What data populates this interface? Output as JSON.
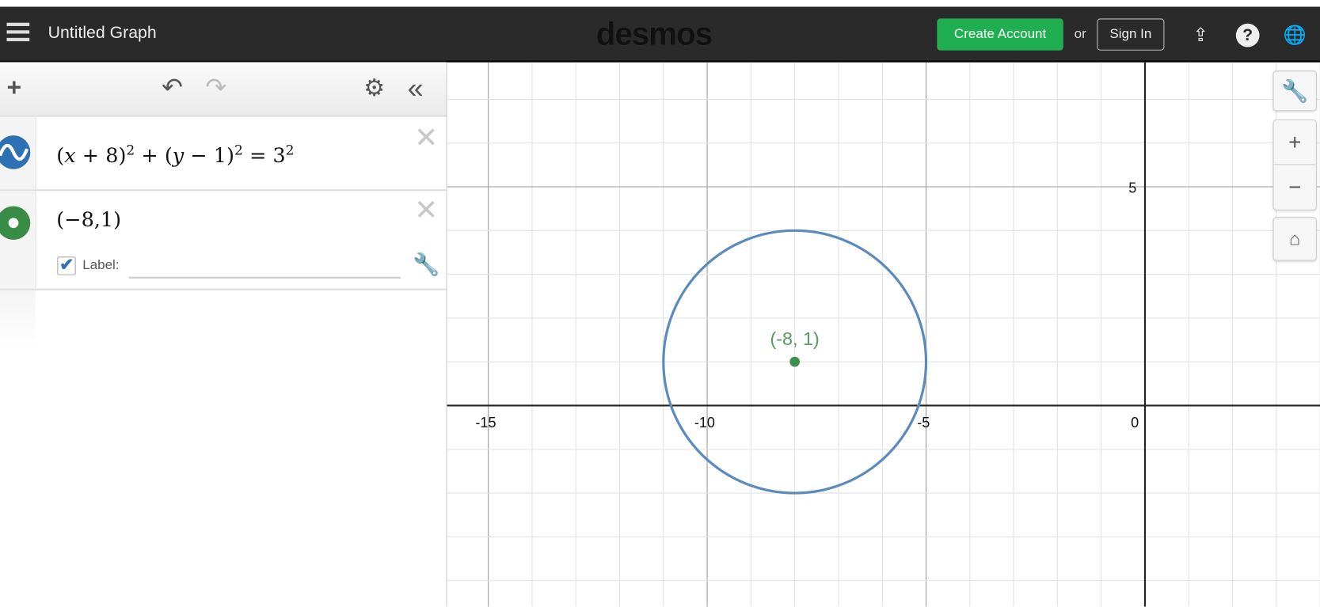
{
  "header": {
    "menu_icon": "hamburger-icon",
    "title": "Untitled Graph",
    "logo": "desmos",
    "create_account": "Create Account",
    "or": "or",
    "sign_in": "Sign In",
    "icons": [
      "share-icon",
      "help-icon",
      "globe-icon"
    ]
  },
  "toolbar": {
    "add": "+",
    "undo": "↶",
    "redo": "↷",
    "settings": "⚙",
    "collapse": "«"
  },
  "expressions": [
    {
      "type": "implicit",
      "color": "#2d70b3",
      "latex": "(x+8)^2+(y-1)^2=3^2"
    },
    {
      "type": "point",
      "color": "#388c46",
      "latex": "(−8,1)",
      "label_checkbox": true,
      "label_text": "Label:",
      "label_value": ""
    }
  ],
  "graph": {
    "x_ticks": [
      "-15",
      "-10",
      "-5",
      "0"
    ],
    "y_ticks": [
      "5"
    ],
    "circle": {
      "cx": -8,
      "cy": 1,
      "r": 3,
      "color": "#5b8bbd"
    },
    "point": {
      "x": -8,
      "y": 1,
      "label": "(-8, 1)",
      "color": "#3f8f4e"
    }
  },
  "controls": {
    "wrench": "wrench-icon",
    "zoom_in": "+",
    "zoom_out": "−",
    "home": "home-icon"
  }
}
